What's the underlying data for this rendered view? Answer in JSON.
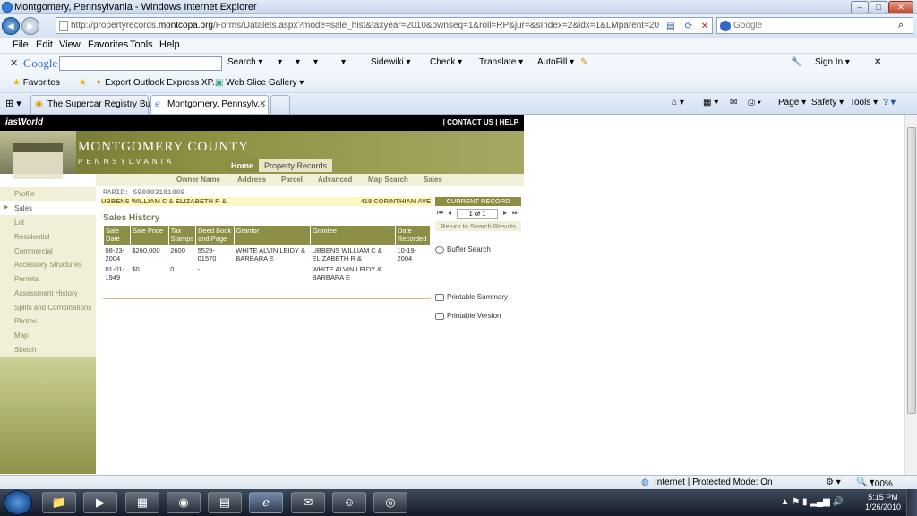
{
  "window": {
    "title": "Montgomery, Pennsylvania - Windows Internet Explorer",
    "min": "–",
    "max": "□",
    "close": "✕"
  },
  "address": {
    "url_prefix": "http://propertyrecords.",
    "url_domain": "montcopa.org",
    "url_rest": "/Forms/Datalets.aspx?mode=sale_hist&taxyear=2010&ownseq=1&roll=RP&jur=&sIndex=2&idx=1&LMparent=20",
    "search_placeholder": "Google"
  },
  "menu": [
    "File",
    "Edit",
    "View",
    "Favorites",
    "Tools",
    "Help"
  ],
  "google_toolbar": {
    "close": "✕",
    "logo": "Google",
    "items": [
      "Search ▾",
      "▾",
      "▾",
      "▾",
      "Sidewiki ▾",
      "Check ▾",
      "Translate ▾",
      "AutoFill ▾"
    ],
    "signin": "Sign In ▾"
  },
  "favorites_bar": {
    "favorites": "Favorites",
    "export": "Export Outlook Express XP...",
    "webslice": "Web Slice Gallery ▾"
  },
  "tabs": [
    {
      "label": "The Supercar Registry Bull..."
    },
    {
      "label": "Montgomery, Pennsylv..."
    }
  ],
  "command_bar": {
    "page": "Page ▾",
    "safety": "Safety ▾",
    "tools": "Tools ▾",
    "help": "? ▾"
  },
  "site": {
    "brand": "iasWorld",
    "contact": "CONTACT US",
    "help": "HELP",
    "county_line1": "MONTGOMERY COUNTY",
    "county_line2": "PENNSYLVANIA",
    "top_tabs": [
      "Home",
      "Property Records"
    ],
    "sub_nav": [
      "Owner Name",
      "Address",
      "Parcel",
      "Advanced",
      "Map Search",
      "Sales"
    ],
    "sidebar": [
      "Profile",
      "Sales",
      "Lot",
      "Residential",
      "Commercial",
      "Accessory Structures",
      "Permits",
      "Assessment History",
      "Splits and Combinations",
      "Photos",
      "Map",
      "Sketch"
    ],
    "selected_sidebar": "Sales",
    "parid_label": "PARID: 590003181009",
    "owner": "UBBENS WILLIAM C & ELIZABETH R &",
    "owner_address": "418 CORINTHIAN AVE",
    "sales_history_title": "Sales History",
    "columns": [
      "Sale Date",
      "Sale Price",
      "Tax Stamps",
      "Deed Book and Page",
      "Grantor",
      "Grantee",
      "Date Recorded"
    ],
    "rows": [
      [
        "08-23-2004",
        "$260,000",
        "2600",
        "5529-01570",
        "WHITE ALVIN LEIDY & BARBARA E",
        "UBBENS WILLIAM C & ELIZABETH R &",
        "10-19-2004"
      ],
      [
        "01-01-1949",
        "$0",
        "0",
        "-",
        "",
        "WHITE ALVIN LEIDY & BARBARA E",
        ""
      ]
    ],
    "current_record": "CURRENT RECORD",
    "record_position": "1 of 1",
    "return_to_results": "Return to Search Results",
    "buffer_search": "Buffer Search",
    "printable_summary": "Printable Summary",
    "printable_version": "Printable Version"
  },
  "statusbar": {
    "zone": "Internet | Protected Mode: On",
    "zoom": "100%"
  },
  "taskbar": {
    "time": "5:15 PM",
    "date": "1/26/2010"
  }
}
